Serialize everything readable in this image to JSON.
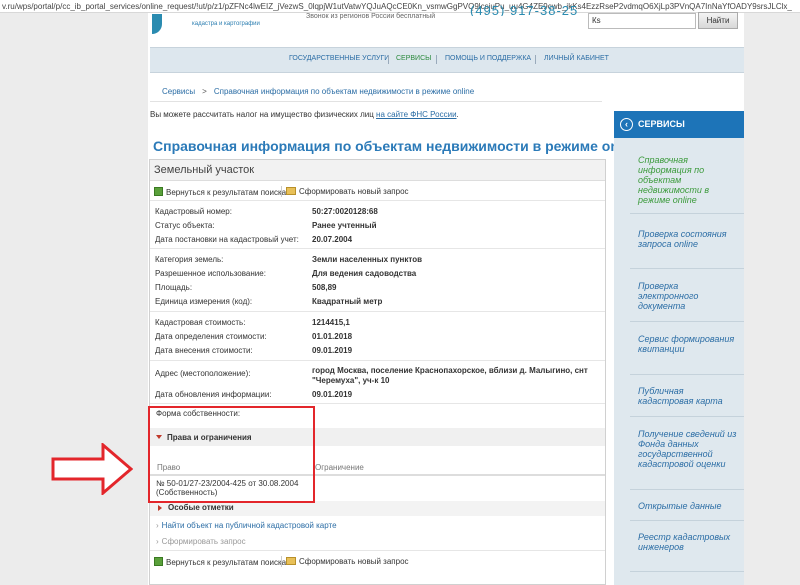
{
  "browser": {
    "url": "v.ru/wps/portal/p/cc_ib_portal_services/online_request/!ut/p/z1/pZFNc4lwEIZ_jVezwS_0lqpjW1utVatwYQJuAQcCE0Kn_vsmwGgPVQ9lcsjuPu_uu4G4ZE9cwb_ikKs4EzzRseP2vdmqO6XjLp3PVnQA7InNaYfOADY9srsJLClx_"
  },
  "header": {
    "logo_line1": "кадастра и картографии",
    "hotline_text": "Звонок из регионов России бесплатный",
    "phone": "(495) 917-38-25",
    "search_value": "Кs",
    "search_button": "Найти"
  },
  "nav": {
    "items": [
      {
        "label": "ГОСУДАРСТВЕННЫЕ УСЛУГИ",
        "active": false
      },
      {
        "label": "СЕРВИСЫ",
        "active": true
      },
      {
        "label": "ПОМОЩЬ И ПОДДЕРЖКА",
        "active": false
      },
      {
        "label": "ЛИЧНЫЙ КАБИНЕТ",
        "active": false
      }
    ]
  },
  "breadcrumb": {
    "root": "Сервисы",
    "separator": ">",
    "current": "Справочная информация по объектам недвижимости в режиме online"
  },
  "tax_note": {
    "text": "Вы можете рассчитать налог на имущество физических лиц",
    "link": "на сайте ФНС России",
    "end": "."
  },
  "page_title": "Справочная информация по объектам недвижимости в режиме online",
  "card": {
    "header": "Земельный участок",
    "back_label": "Вернуться к результатам поиска",
    "new_request_label": "Сформировать новый запрос"
  },
  "fields": [
    {
      "label": "Кадастровый номер:",
      "value": "50:27:0020128:68"
    },
    {
      "label": "Статус объекта:",
      "value": "Ранее учтенный"
    },
    {
      "label": "Дата постановки на кадастровый учет:",
      "value": "20.07.2004"
    },
    {
      "label": "Категория земель:",
      "value": "Земли населенных пунктов"
    },
    {
      "label": "Разрешенное использование:",
      "value": "Для ведения садоводства"
    },
    {
      "label": "Площадь:",
      "value": "508,89"
    },
    {
      "label": "Единица измерения (код):",
      "value": "Квадратный метр"
    },
    {
      "label": "Кадастровая стоимость:",
      "value": "1214415,1"
    },
    {
      "label": "Дата определения стоимости:",
      "value": "01.01.2018"
    },
    {
      "label": "Дата внесения стоимости:",
      "value": "09.01.2019"
    },
    {
      "label": "Адрес (местоположение):",
      "value_line1": "город Москва, поселение Краснопахорское, вблизи д. Малыгино, снт",
      "value_line2": "\"Черемуха\", уч-к 10"
    },
    {
      "label": "Дата обновления информации:",
      "value": "09.01.2019"
    }
  ],
  "ownership_label": "Форма собственности:",
  "rights": {
    "title": "Права и ограничения",
    "col_right": "Право",
    "col_restriction": "Ограничение",
    "row_line1": "№ 50-01/27-23/2004-425  от 30.08.2004",
    "row_line2": "(Собственность)"
  },
  "special": {
    "title": "Особые отметки",
    "map_link": "Найти объект на публичной кадастровой карте",
    "new_request_link": "Сформировать запрос"
  },
  "sidebar": {
    "title": "СЕРВИСЫ",
    "items": [
      {
        "label": "Справочная информация по объектам недвижимости в режиме online",
        "active": true
      },
      {
        "label": "Проверка состояния запроса online",
        "active": false
      },
      {
        "label": "Проверка электронного документа",
        "active": false
      },
      {
        "label": "Сервис формирования квитанции",
        "active": false
      },
      {
        "label": "Публичная кадастровая карта",
        "active": false
      },
      {
        "label": "Получение сведений из Фонда данных государственной кадастровой оценки",
        "active": false
      },
      {
        "label": "Открытые данные",
        "active": false
      },
      {
        "label": "Реестр кадастровых инженеров",
        "active": false
      }
    ]
  },
  "colors": {
    "accent": "#1d74b8",
    "link": "#2b6da5",
    "active_green": "#3b9a3b",
    "annotation_red": "#e3262b"
  }
}
